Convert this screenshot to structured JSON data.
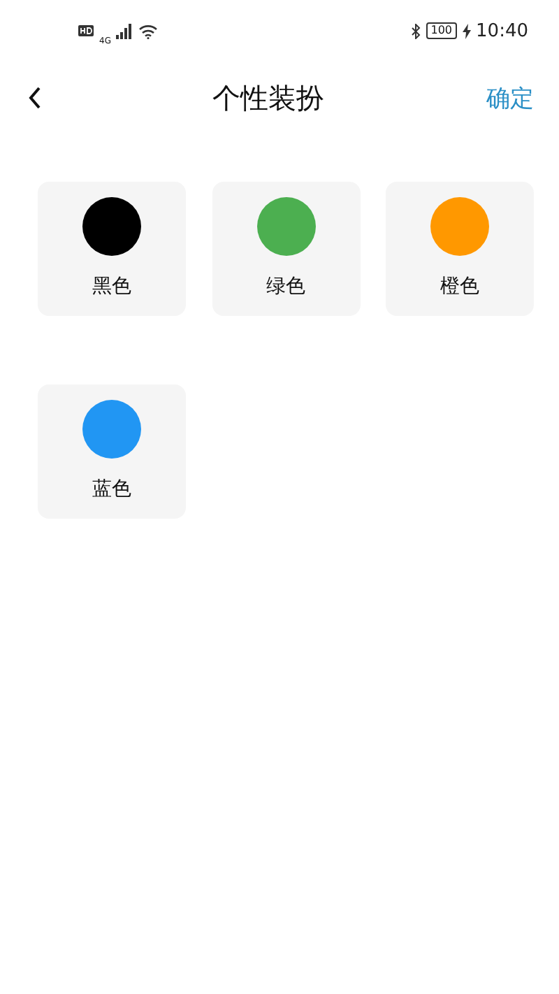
{
  "status_bar": {
    "network": "4G",
    "battery": "100",
    "time": "10:40"
  },
  "header": {
    "title": "个性装扮",
    "confirm": "确定"
  },
  "colors": [
    {
      "label": "黑色",
      "color": "#000000"
    },
    {
      "label": "绿色",
      "color": "#4caf50"
    },
    {
      "label": "橙色",
      "color": "#ff9800"
    },
    {
      "label": "蓝色",
      "color": "#2196f3"
    }
  ]
}
